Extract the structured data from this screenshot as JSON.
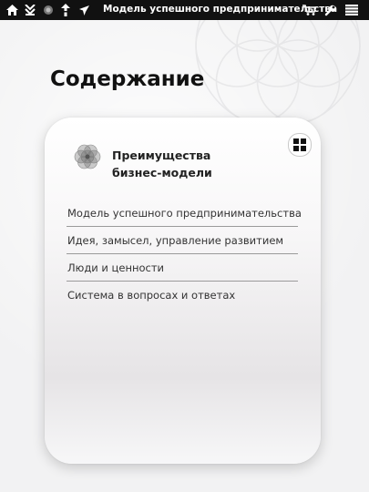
{
  "topbar": {
    "title": "Модель успешного предпринимательства",
    "left_icons": [
      "home-icon",
      "download-icon",
      "rosette-icon",
      "upload-icon",
      "airplane-icon"
    ],
    "right_icons": [
      "cart-icon",
      "wrench-icon",
      "list-icon"
    ]
  },
  "page": {
    "heading": "Содержание"
  },
  "card": {
    "title_line1": "Преимущества",
    "title_line2": "бизнес-модели",
    "items": [
      {
        "label": "Модель успешного предпринимательства"
      },
      {
        "label": "Идея, замысел, управление развитием"
      },
      {
        "label": "Люди и ценности"
      },
      {
        "label": "Система в вопросах и ответах"
      }
    ]
  }
}
